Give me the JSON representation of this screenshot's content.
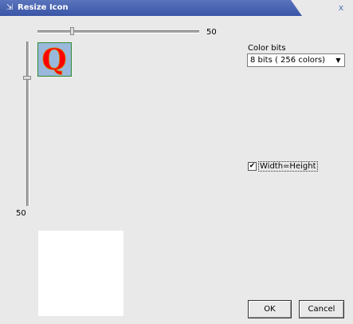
{
  "window": {
    "title": "Resize Icon",
    "title_icon": "resize-icon",
    "close_glyph": "x"
  },
  "width_slider": {
    "value_label": "50",
    "level": 0.2
  },
  "height_slider": {
    "value_label": "50",
    "level": 0.2
  },
  "color_bits": {
    "label": "Color bits",
    "selected": "8 bits ( 256  colors)"
  },
  "width_equals_height": {
    "label": "Width=Height",
    "checked": true
  },
  "buttons": {
    "ok": "OK",
    "cancel": "Cancel"
  },
  "icon": {
    "letter": "Q",
    "background": "#9ab8dc",
    "letter_color": "#ff0000"
  }
}
